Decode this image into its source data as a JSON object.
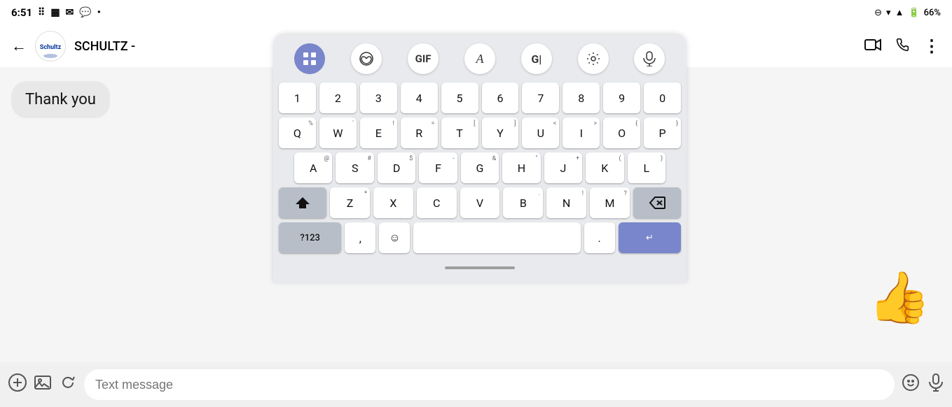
{
  "status_bar": {
    "time": "6:51",
    "battery": "66%"
  },
  "app_bar": {
    "back_label": "←",
    "contact_name": "SCHULTZ -",
    "logo_text": "Schultz"
  },
  "chat": {
    "message": "Thank you",
    "thumbs_up": "👍"
  },
  "bottom_bar": {
    "text_message_placeholder": "Text message"
  },
  "keyboard": {
    "toolbar": {
      "grid_icon": "⊞",
      "emoji_icon": "☺",
      "gif_label": "GIF",
      "translate_a": "A",
      "translate_g": "G",
      "settings_icon": "⚙",
      "mic_icon": "🎤"
    },
    "row_numbers": [
      "1",
      "2",
      "3",
      "4",
      "5",
      "6",
      "7",
      "8",
      "9",
      "0"
    ],
    "row1_sup": [
      "",
      "",
      "",
      "",
      "",
      "",
      "",
      "",
      "",
      ""
    ],
    "row_qwerty": [
      {
        "key": "Q",
        "sup": "%"
      },
      {
        "key": "W",
        "sup": "'"
      },
      {
        "key": "E",
        "sup": "!"
      },
      {
        "key": "R",
        "sup": "="
      },
      {
        "key": "T",
        "sup": "["
      },
      {
        "key": "Y",
        "sup": "]"
      },
      {
        "key": "U",
        "sup": "<"
      },
      {
        "key": "I",
        "sup": ">"
      },
      {
        "key": "O",
        "sup": "{"
      },
      {
        "key": "P",
        "sup": "}"
      }
    ],
    "row_asdf": [
      {
        "key": "A",
        "sup": "@"
      },
      {
        "key": "S",
        "sup": "#"
      },
      {
        "key": "D",
        "sup": "$"
      },
      {
        "key": "F",
        "sup": "-"
      },
      {
        "key": "G",
        "sup": "&"
      },
      {
        "key": "H",
        "sup": "\""
      },
      {
        "key": "J",
        "sup": "+"
      },
      {
        "key": "K",
        "sup": "("
      },
      {
        "key": "L",
        "sup": ")"
      }
    ],
    "row_zxcv": [
      {
        "key": "Z",
        "sup": "*"
      },
      {
        "key": "X",
        "sup": ""
      },
      {
        "key": "C",
        "sup": ""
      },
      {
        "key": "V",
        "sup": ""
      },
      {
        "key": "B",
        "sup": "."
      },
      {
        "key": "N",
        "sup": "!"
      },
      {
        "key": "M",
        "sup": "?"
      }
    ],
    "row_bottom": {
      "num_label": "?123",
      "comma": ",",
      "emoji": "☺",
      "period": ".",
      "enter_icon": "↵"
    }
  }
}
